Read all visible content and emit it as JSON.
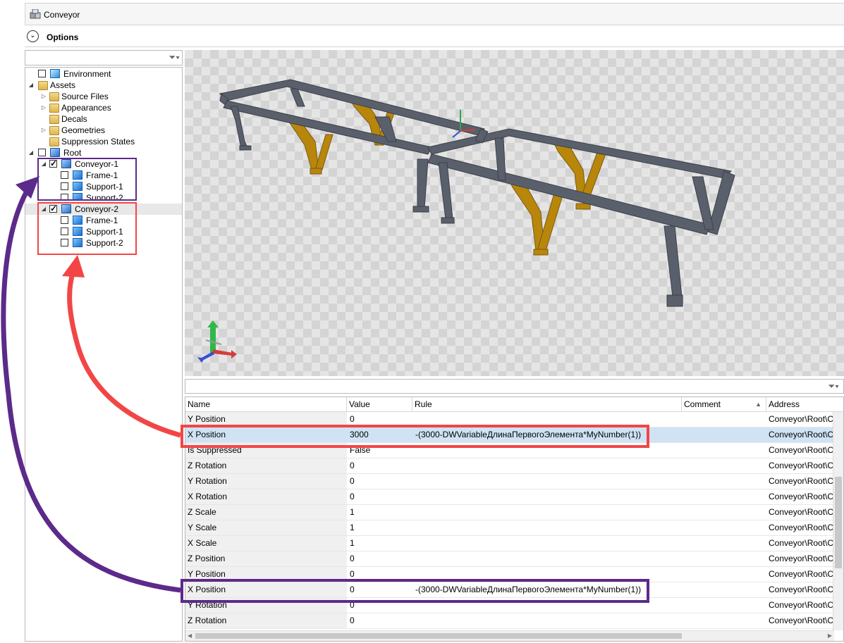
{
  "window": {
    "title": "Conveyor"
  },
  "options": {
    "label": "Options"
  },
  "tree": {
    "items": [
      {
        "label": "Environment"
      },
      {
        "label": "Assets"
      },
      {
        "label": "Source Files"
      },
      {
        "label": "Appearances"
      },
      {
        "label": "Decals"
      },
      {
        "label": "Geometries"
      },
      {
        "label": "Suppression States"
      },
      {
        "label": "Root"
      },
      {
        "label": "Conveyor-1"
      },
      {
        "label": "Frame-1"
      },
      {
        "label": "Support-1"
      },
      {
        "label": "Support-2"
      },
      {
        "label": "Conveyor-2"
      },
      {
        "label": "Frame-1"
      },
      {
        "label": "Support-1"
      },
      {
        "label": "Support-2"
      }
    ]
  },
  "grid": {
    "columns": {
      "name": "Name",
      "value": "Value",
      "rule": "Rule",
      "comment": "Comment",
      "address": "Address"
    },
    "rows": [
      {
        "name": "Y Position",
        "value": "0",
        "rule": "",
        "address": "Conveyor\\Root\\C"
      },
      {
        "name": "X Position",
        "value": "3000",
        "rule": "-(3000-DWVariableДлинаПервогоЭлемента*MyNumber(1))",
        "address": "Conveyor\\Root\\C"
      },
      {
        "name": "Is Suppressed",
        "value": "False",
        "rule": "",
        "address": "Conveyor\\Root\\C"
      },
      {
        "name": "Z Rotation",
        "value": "0",
        "rule": "",
        "address": "Conveyor\\Root\\C"
      },
      {
        "name": "Y Rotation",
        "value": "0",
        "rule": "",
        "address": "Conveyor\\Root\\C"
      },
      {
        "name": "X Rotation",
        "value": "0",
        "rule": "",
        "address": "Conveyor\\Root\\C"
      },
      {
        "name": "Z Scale",
        "value": "1",
        "rule": "",
        "address": "Conveyor\\Root\\C"
      },
      {
        "name": "Y Scale",
        "value": "1",
        "rule": "",
        "address": "Conveyor\\Root\\C"
      },
      {
        "name": "X Scale",
        "value": "1",
        "rule": "",
        "address": "Conveyor\\Root\\C"
      },
      {
        "name": "Z Position",
        "value": "0",
        "rule": "",
        "address": "Conveyor\\Root\\C"
      },
      {
        "name": "Y Position",
        "value": "0",
        "rule": "",
        "address": "Conveyor\\Root\\C"
      },
      {
        "name": "X Position",
        "value": "0",
        "rule": "-(3000-DWVariableДлинаПервогоЭлемента*MyNumber(1))",
        "address": "Conveyor\\Root\\C"
      },
      {
        "name": "Y Rotation",
        "value": "0",
        "rule": "",
        "address": "Conveyor\\Root\\C"
      },
      {
        "name": "Z Rotation",
        "value": "0",
        "rule": "",
        "address": "Conveyor\\Root\\C"
      }
    ]
  },
  "colors": {
    "red_annotation": "#f24646",
    "purple_annotation": "#5c2a8a",
    "selection": "#cfe3f5",
    "steel": "#5a606b",
    "yellow_support": "#b8860b"
  }
}
